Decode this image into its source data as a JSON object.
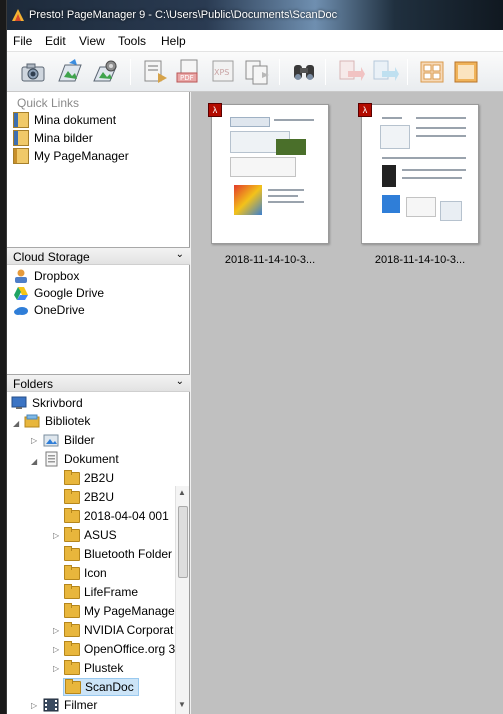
{
  "window": {
    "title": "Presto! PageManager 9  - C:\\Users\\Public\\Documents\\ScanDoc"
  },
  "menu": [
    "File",
    "Edit",
    "View",
    "Tools",
    "Help"
  ],
  "toolbar": {
    "icons": [
      "scan-camera-icon",
      "acquire-icon",
      "batch-icon",
      "export-icon",
      "pdf-icon",
      "xps-icon",
      "convert-icon",
      "find-binoculars-icon",
      "send-icon",
      "send-to-icon",
      "thumbnail-view-icon",
      "detail-view-icon"
    ]
  },
  "quick_links": {
    "title": "Quick Links",
    "items": [
      "Mina dokument",
      "Mina bilder",
      "My PageManager"
    ]
  },
  "cloud_storage": {
    "title": "Cloud Storage",
    "items": [
      "Dropbox",
      "Google Drive",
      "OneDrive"
    ]
  },
  "folders": {
    "title": "Folders",
    "tree": [
      {
        "label": "Skrivbord",
        "level": 0,
        "twisty": "",
        "icon": "desktop"
      },
      {
        "label": "Bibliotek",
        "level": 1,
        "twisty": "◢",
        "icon": "library"
      },
      {
        "label": "Bilder",
        "level": 2,
        "twisty": "▷",
        "icon": "pictures"
      },
      {
        "label": "Dokument",
        "level": 2,
        "twisty": "◢",
        "icon": "documents"
      },
      {
        "label": "2B2U",
        "level": 3,
        "twisty": "",
        "icon": "folder"
      },
      {
        "label": "2B2U",
        "level": 3,
        "twisty": "",
        "icon": "folder"
      },
      {
        "label": "2018-04-04 001",
        "level": 3,
        "twisty": "",
        "icon": "folder"
      },
      {
        "label": "ASUS",
        "level": 3,
        "twisty": "▷",
        "icon": "folder"
      },
      {
        "label": "Bluetooth Folder",
        "level": 3,
        "twisty": "",
        "icon": "folder"
      },
      {
        "label": "Icon",
        "level": 3,
        "twisty": "",
        "icon": "folder"
      },
      {
        "label": "LifeFrame",
        "level": 3,
        "twisty": "",
        "icon": "folder"
      },
      {
        "label": "My PageManage",
        "level": 3,
        "twisty": "",
        "icon": "folder"
      },
      {
        "label": "NVIDIA Corporat",
        "level": 3,
        "twisty": "▷",
        "icon": "folder"
      },
      {
        "label": "OpenOffice.org 3",
        "level": 3,
        "twisty": "▷",
        "icon": "folder"
      },
      {
        "label": "Plustek",
        "level": 3,
        "twisty": "▷",
        "icon": "folder"
      },
      {
        "label": "ScanDoc",
        "level": 3,
        "twisty": "",
        "icon": "folder",
        "selected": true
      },
      {
        "label": "Filmer",
        "level": 2,
        "twisty": "▷",
        "icon": "videos"
      }
    ]
  },
  "documents": [
    {
      "label": "2018-11-14-10-3...",
      "badge": "PDF"
    },
    {
      "label": "2018-11-14-10-3...",
      "badge": "PDF"
    }
  ],
  "colors": {
    "selection": "#cce4f7",
    "workspace": "#c0c0c0",
    "pdf_badge": "#b30b00"
  }
}
